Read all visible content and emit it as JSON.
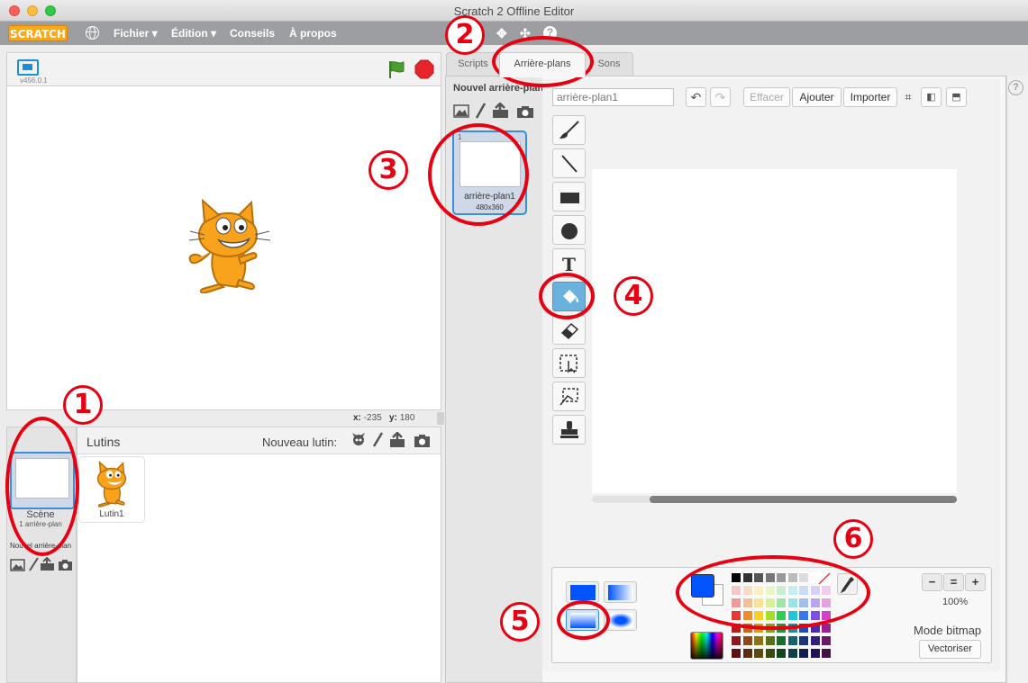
{
  "window": {
    "title": "Scratch 2 Offline Editor"
  },
  "menubar": {
    "logo": "SCRATCH",
    "file": "Fichier ▾",
    "edit": "Édition ▾",
    "tips": "Conseils",
    "about": "À propos",
    "help": "?"
  },
  "stage": {
    "version": "v456.0.1",
    "x_label": "x:",
    "x_value": "-235",
    "y_label": "y:",
    "y_value": "180"
  },
  "scene": {
    "label": "Scène",
    "sub": "1 arrière-plan",
    "new_backdrop": "Nouvel arrière-plan"
  },
  "sprites": {
    "title": "Lutins",
    "new_sprite": "Nouveau lutin:",
    "items": [
      {
        "name": "Lutin1"
      }
    ]
  },
  "tabs": [
    {
      "label": "Scripts"
    },
    {
      "label": "Arrière-plans"
    },
    {
      "label": "Sons"
    }
  ],
  "backdrops": {
    "new_title": "Nouvel arrière-plan",
    "items": [
      {
        "index": "1",
        "name": "arrière-plan1",
        "size": "480x360"
      }
    ]
  },
  "paint": {
    "name_value": "arrière-plan1",
    "clear": "Effacer",
    "add": "Ajouter",
    "import": "Importer",
    "zoom": "100%",
    "mode": "Mode bitmap",
    "convert": "Vectoriser",
    "primary_color": "#0054ff",
    "secondary_color": "#ffffff"
  },
  "tools": [
    "brush-icon",
    "line-icon",
    "rectangle-icon",
    "ellipse-icon",
    "text-icon",
    "fill-bucket-icon",
    "eraser-icon",
    "select-icon",
    "select-and-duplicate-icon",
    "stamp-icon"
  ],
  "annotations": [
    "1",
    "2",
    "3",
    "4",
    "5",
    "6"
  ],
  "palette_colors": [
    "#000000",
    "#333333",
    "#555555",
    "#777777",
    "#999999",
    "#bbbbbb",
    "#dddddd",
    "#ffffff",
    "transparent",
    "#f4c7c7",
    "#f9dcc4",
    "#fbeec4",
    "#e9f6c4",
    "#c8f0cf",
    "#c6eef2",
    "#c9dcf6",
    "#d9cff6",
    "#f0cdee",
    "#ef9a9a",
    "#f5bf94",
    "#fae196",
    "#d7ef96",
    "#9ee6a8",
    "#99e2ea",
    "#9fc0ef",
    "#baa4ee",
    "#e5a4e1",
    "#e53935",
    "#ef8c2e",
    "#f7d02c",
    "#a6dc2a",
    "#33cc52",
    "#27c3d6",
    "#3478ef",
    "#7c4fe6",
    "#d43fc7",
    "#b71c1c",
    "#c8651a",
    "#c9a21a",
    "#7aa51c",
    "#1f9a3a",
    "#1a8fa0",
    "#1b4fb5",
    "#4f2aa8",
    "#9c208f",
    "#8a1a1a",
    "#8e4716",
    "#8e7216",
    "#586f18",
    "#1b6a2e",
    "#166270",
    "#19347a",
    "#34207a",
    "#6b1966",
    "#5c1212",
    "#5c2e0f",
    "#5c4a0f",
    "#3a4a10",
    "#12461f",
    "#10414a",
    "#121f52",
    "#211452",
    "#461042"
  ]
}
